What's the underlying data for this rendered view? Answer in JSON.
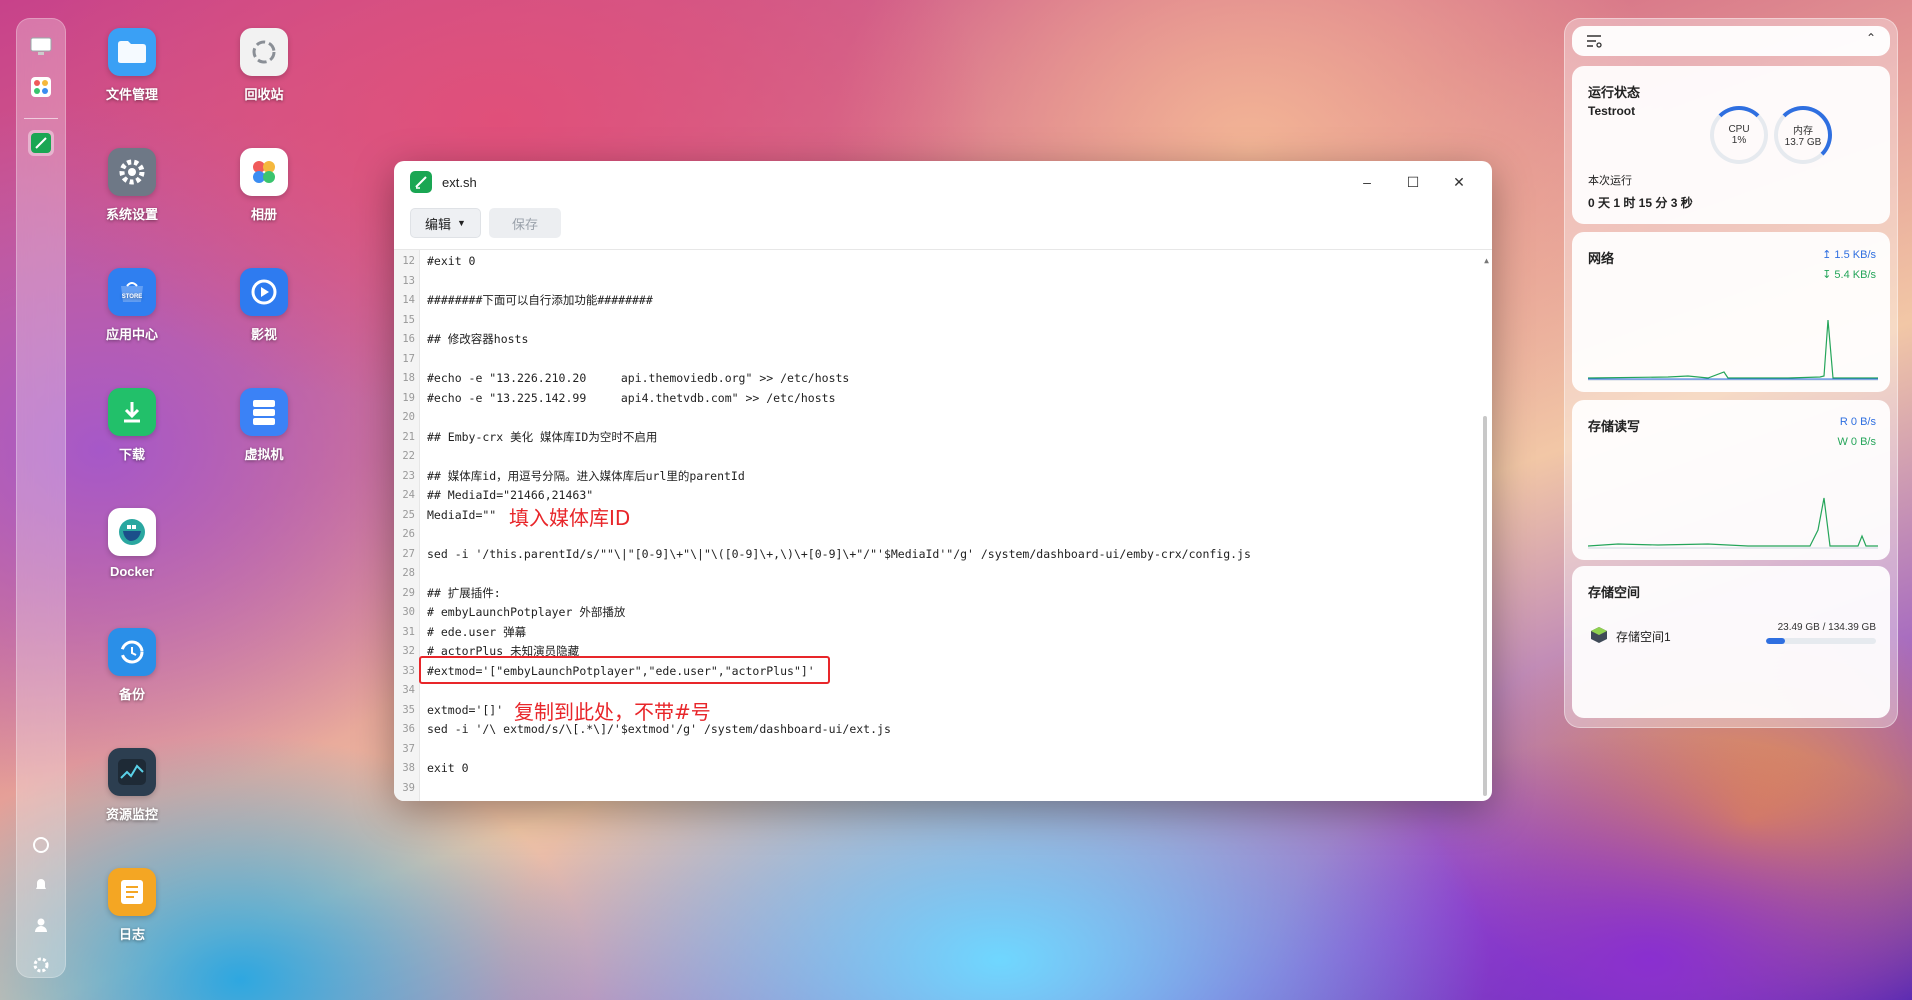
{
  "sidebar": {
    "icons": [
      "monitor-icon",
      "apps-grid-icon",
      "editor-app-icon",
      "help-icon",
      "bell-icon",
      "user-icon",
      "settings-icon"
    ]
  },
  "desktop": {
    "left_column": [
      {
        "label": "文件管理",
        "icon": "folder-icon",
        "color": "#3aa0f5"
      },
      {
        "label": "系统设置",
        "icon": "gear-icon",
        "color": "#6e7886"
      },
      {
        "label": "应用中心",
        "icon": "store-icon",
        "color": "#2f7ff0"
      },
      {
        "label": "下载",
        "icon": "download-icon",
        "color": "#22c06a"
      },
      {
        "label": "Docker",
        "icon": "docker-icon",
        "color": "#ffffff"
      },
      {
        "label": "备份",
        "icon": "backup-icon",
        "color": "#2a8fe8"
      },
      {
        "label": "资源监控",
        "icon": "monitor-chart-icon",
        "color": "#2c3e50"
      },
      {
        "label": "日志",
        "icon": "log-icon",
        "color": "#f4a623"
      }
    ],
    "right_column": [
      {
        "label": "回收站",
        "icon": "recycle-bin-icon",
        "color": "#f2f2f2"
      },
      {
        "label": "相册",
        "icon": "photos-icon",
        "color": "#ffffff"
      },
      {
        "label": "影视",
        "icon": "video-icon",
        "color": "#2e7bf0"
      },
      {
        "label": "虚拟机",
        "icon": "vm-icon",
        "color": "#3b82f6"
      }
    ]
  },
  "window": {
    "title": "ext.sh",
    "edit_menu": "编辑",
    "save": "保存",
    "lines": [
      {
        "n": "12",
        "code": "#exit 0"
      },
      {
        "n": "13",
        "code": ""
      },
      {
        "n": "14",
        "code": "########下面可以自行添加功能########"
      },
      {
        "n": "15",
        "code": ""
      },
      {
        "n": "16",
        "code": "## 修改容器hosts"
      },
      {
        "n": "17",
        "code": ""
      },
      {
        "n": "18",
        "code": "#echo -e \"13.226.210.20     api.themoviedb.org\" >> /etc/hosts"
      },
      {
        "n": "19",
        "code": "#echo -e \"13.225.142.99     api4.thetvdb.com\" >> /etc/hosts"
      },
      {
        "n": "20",
        "code": ""
      },
      {
        "n": "21",
        "code": "## Emby-crx 美化 媒体库ID为空时不启用"
      },
      {
        "n": "22",
        "code": ""
      },
      {
        "n": "23",
        "code": "## 媒体库id，用逗号分隔。进入媒体库后url里的parentId"
      },
      {
        "n": "24",
        "code": "## MediaId=\"21466,21463\""
      },
      {
        "n": "25",
        "code": "MediaId=\"\""
      },
      {
        "n": "26",
        "code": ""
      },
      {
        "n": "27",
        "code": "sed -i '/this.parentId/s/\"\"\\|\"[0-9]\\+\"\\|\"\\([0-9]\\+,\\)\\+[0-9]\\+\"/\"'$MediaId'\"/g' /system/dashboard-ui/emby-crx/config.js"
      },
      {
        "n": "28",
        "code": ""
      },
      {
        "n": "29",
        "code": "## 扩展插件:"
      },
      {
        "n": "30",
        "code": "# embyLaunchPotplayer 外部播放"
      },
      {
        "n": "31",
        "code": "# ede.user 弹幕"
      },
      {
        "n": "32",
        "code": "# actorPlus 未知演员隐藏"
      },
      {
        "n": "33",
        "code": "#extmod='[\"embyLaunchPotplayer\",\"ede.user\",\"actorPlus\"]'"
      },
      {
        "n": "34",
        "code": ""
      },
      {
        "n": "35",
        "code": "extmod='[]'"
      },
      {
        "n": "36",
        "code": "sed -i '/\\ extmod/s/\\[.*\\]/'$extmod'/g' /system/dashboard-ui/ext.js"
      },
      {
        "n": "37",
        "code": ""
      },
      {
        "n": "38",
        "code": "exit 0"
      },
      {
        "n": "39",
        "code": ""
      }
    ],
    "annotation_1": "填入媒体库ID",
    "annotation_2": "复制到此处，不带#号"
  },
  "widgets": {
    "status": {
      "title": "运行状态",
      "host": "Testroot",
      "uptime_label": "本次运行",
      "uptime": "0 天 1 时 15 分 3 秒",
      "cpu_label": "CPU",
      "cpu_value": "1%",
      "mem_label": "内存",
      "mem_value": "13.7 GB",
      "cpu_fraction": 0.01,
      "mem_fraction": 0.22
    },
    "network": {
      "title": "网络",
      "up": "1.5 KB/s",
      "down": "5.4 KB/s"
    },
    "disk_io": {
      "title": "存储读写",
      "read": "R  0 B/s",
      "write": "W  0 B/s"
    },
    "storage": {
      "title": "存储空间",
      "name": "存储空间1",
      "usage": "23.49 GB / 134.39 GB",
      "used_fraction": 0.175
    }
  },
  "colors": {
    "accent": "#2f6fe0",
    "green": "#25a55a",
    "annotation": "#e8262a"
  }
}
